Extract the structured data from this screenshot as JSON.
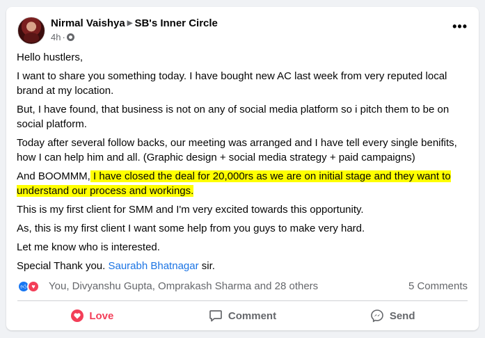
{
  "post": {
    "author": "Nirmal Vaishya",
    "group": "SB's Inner Circle",
    "time": "4h",
    "dot": "·",
    "more_label": "•••"
  },
  "body": {
    "p1": "Hello hustlers,",
    "p2": "I want to share you something today. I have bought new AC last week from very reputed local brand at my location.",
    "p3": "But, I have found, that business is not on any of social media platform so i pitch them to be on social platform.",
    "p4": "Today after several follow backs, our meeting was arranged and I have tell every single benifits, how I can help him and all. (Graphic design + social media strategy + paid campaigns)",
    "p5_prefix": "And BOOMMM,",
    "p5_highlight": " I have closed the deal for 20,000rs as we are on initial stage and they want to understand our process and workings.",
    "p6": "This is my first client for SMM and I'm very excited towards this opportunity.",
    "p7": "As, this is my first client I want some help from you guys to make very hard.",
    "p8": "Let me know who is interested.",
    "p9_prefix": "Special Thank you. ",
    "p9_link": "Saurabh Bhatnagar",
    "p9_suffix": " sir."
  },
  "reactions": {
    "summary": "You, Divyanshu Gupta, Omprakash Sharma and 28 others",
    "comments": "5 Comments",
    "icons": [
      "like-icon",
      "love-icon"
    ]
  },
  "actions": {
    "love": "Love",
    "comment": "Comment",
    "send": "Send"
  },
  "colors": {
    "love": "#f33e58",
    "like": "#1877f2",
    "link": "#1b74e4",
    "highlight": "#ffff00"
  }
}
